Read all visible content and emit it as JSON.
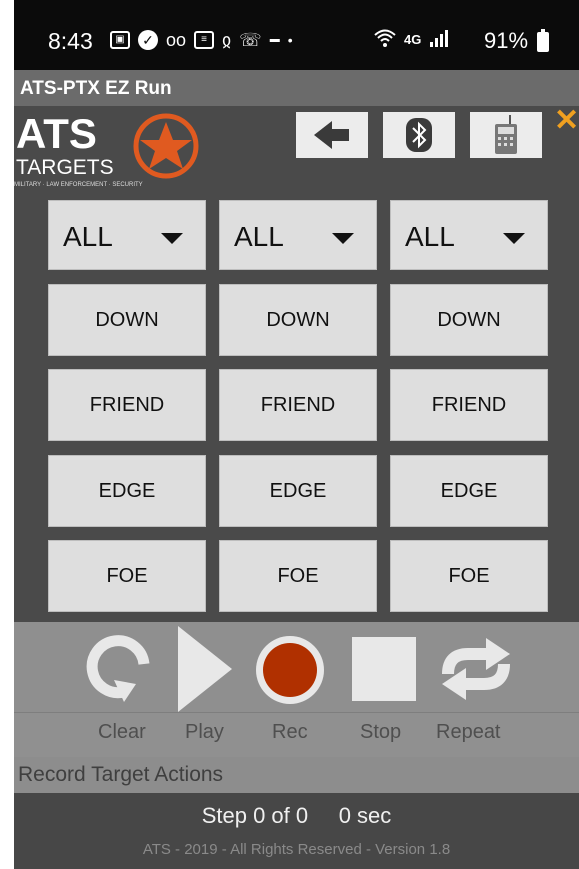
{
  "status_bar": {
    "time": "8:43",
    "battery_percent": "91%",
    "notification_icons": [
      "gallery-icon",
      "check-icon",
      "voicemail-icon",
      "news-icon",
      "messenger-icon",
      "wifi-calling-icon",
      "gov-icon",
      "dot-icon"
    ],
    "system_icons": [
      "wifi-icon",
      "4g-lte-icon",
      "signal-icon",
      "battery-icon"
    ]
  },
  "app": {
    "title": "ATS-PTX EZ Run"
  },
  "logo": {
    "brand_top": "ATS",
    "brand_bottom": "TARGETS",
    "tagline": "MILITARY · LAW ENFORCEMENT · SECURITY"
  },
  "header_buttons": [
    "back-arrow-icon",
    "bluetooth-icon",
    "remote-controller-icon"
  ],
  "close_label": "✕",
  "columns": [
    {
      "selector": "ALL",
      "buttons": [
        "DOWN",
        "FRIEND",
        "EDGE",
        "FOE"
      ]
    },
    {
      "selector": "ALL",
      "buttons": [
        "DOWN",
        "FRIEND",
        "EDGE",
        "FOE"
      ]
    },
    {
      "selector": "ALL",
      "buttons": [
        "DOWN",
        "FRIEND",
        "EDGE",
        "FOE"
      ]
    }
  ],
  "controls": {
    "clear_label": "Clear",
    "play_label": "Play",
    "rec_label": "Rec",
    "stop_label": "Stop",
    "repeat_label": "Repeat"
  },
  "record_title": "Record Target Actions",
  "step_text": "Step 0 of 0     0 sec",
  "footer_text": "ATS - 2019 - All Rights Reserved - Version 1.8",
  "colors": {
    "rec_button": "#b03000",
    "logo_star": "#e05a20",
    "close_x": "#f0a020",
    "button_face": "#dedede",
    "background": "#4a4a4a"
  }
}
